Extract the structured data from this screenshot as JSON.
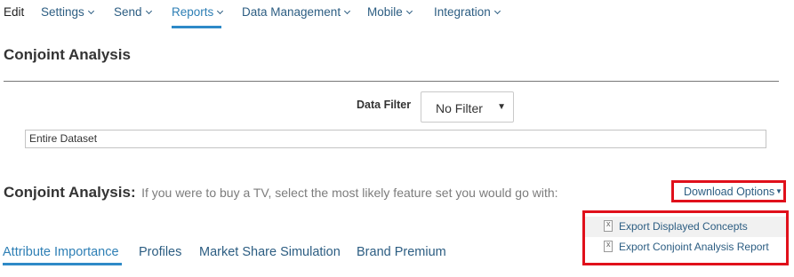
{
  "nav": {
    "edit": "Edit",
    "items": [
      {
        "label": "Settings"
      },
      {
        "label": "Send"
      },
      {
        "label": "Reports"
      },
      {
        "label": "Data Management"
      },
      {
        "label": "Mobile"
      },
      {
        "label": "Integration"
      }
    ],
    "active": "Reports"
  },
  "page": {
    "title": "Conjoint Analysis"
  },
  "filter": {
    "label": "Data Filter",
    "selected": "No Filter",
    "dataset": "Entire Dataset"
  },
  "section": {
    "title": "Conjoint Analysis:",
    "prompt": "If you were to buy a TV, select the most likely feature set you would go with:"
  },
  "download": {
    "label": "Download Options",
    "options": [
      {
        "label": "Export Displayed Concepts",
        "icon": "excel-file-icon"
      },
      {
        "label": "Export Conjoint Analysis Report",
        "icon": "excel-file-icon"
      }
    ]
  },
  "tabs": [
    {
      "label": "Attribute Importance"
    },
    {
      "label": "Profiles"
    },
    {
      "label": "Market Share Simulation"
    },
    {
      "label": "Brand Premium"
    }
  ],
  "colors": {
    "link": "#2c5d82",
    "active_accent": "#2e8ac8",
    "highlight_box": "#e0101b"
  }
}
